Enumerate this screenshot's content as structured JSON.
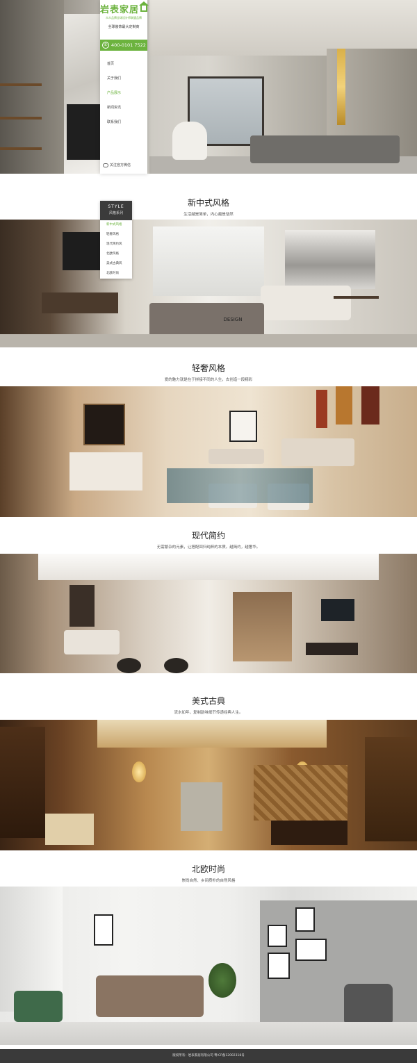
{
  "brand": {
    "logo_text": "岩表家居",
    "logo_sub": "众众品牌全球设计师联盟品牌",
    "slogan": "全球装饰最大定制商",
    "phone": "400-0101 7522",
    "accent": "#6cb33e"
  },
  "nav": {
    "items": [
      {
        "label": "首页",
        "active": false
      },
      {
        "label": "关于我们",
        "active": false
      },
      {
        "label": "产品展示",
        "active": true
      },
      {
        "label": "新闻资讯",
        "active": false
      },
      {
        "label": "联系我们",
        "active": false
      }
    ],
    "wechat_label": "关注官方微信"
  },
  "style_menu": {
    "title_en": "STYLE",
    "title_cn": "风格系列",
    "items": [
      {
        "label": "新中式风格",
        "active": true
      },
      {
        "label": "轻奢风格",
        "active": false
      },
      {
        "label": "现代简约风",
        "active": false
      },
      {
        "label": "北欧风格",
        "active": false
      },
      {
        "label": "美式古典风",
        "active": false
      },
      {
        "label": "北欧时尚",
        "active": false
      }
    ]
  },
  "sections": [
    {
      "title": "新中式风格",
      "desc": "生活越是简单，内心越是恬然"
    },
    {
      "title": "轻奢风格",
      "desc": "爱的魅力就是在于拼接不同的人生，去创造一段精彩"
    },
    {
      "title": "现代简约",
      "desc": "无需繁杂的元素，让搭配回归纯粹的本质。越简约，越奢华。"
    },
    {
      "title": "美式古典",
      "desc": "流水如年，复制韵味细节传递经典人生。"
    },
    {
      "title": "北欧时尚",
      "desc": "崇尚自然、乡间质朴的自然风格"
    }
  ],
  "watermark": "DESIGN",
  "footer": {
    "text": "版权所有：岩表家居有限公司   粤ICP备12002318号"
  }
}
